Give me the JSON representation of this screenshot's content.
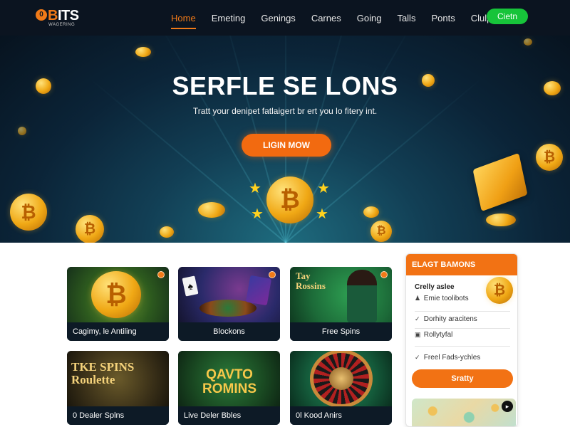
{
  "nav": {
    "logo_mark": "0",
    "logo_main": "BITS",
    "logo_tag": "WAGERING",
    "items": [
      {
        "label": "Home",
        "active": true
      },
      {
        "label": "Emeting",
        "active": false
      },
      {
        "label": "Genings",
        "active": false
      },
      {
        "label": "Carnes",
        "active": false
      },
      {
        "label": "Going",
        "active": false
      },
      {
        "label": "Talls",
        "active": false
      },
      {
        "label": "Ponts",
        "active": false
      },
      {
        "label": "Clulp",
        "active": false
      }
    ],
    "join_label": "Cietn"
  },
  "hero": {
    "title": "SERFLE SE LONS",
    "subtitle": "Tratt your denipet fatlaigert br ert you lo fitery int.",
    "button_label": "LIGIN MOW",
    "coin_symbol": "₿"
  },
  "cards": [
    {
      "label": "Cagimy, le Antiling",
      "art": "₿"
    },
    {
      "label": "Blockons",
      "art": "♠"
    },
    {
      "label": "Free Spins",
      "art": "Tay Rossins"
    },
    {
      "label": "0 Dealer Splns",
      "art": "TKE SPINS Roulette"
    },
    {
      "label": "Live Deler Bbles",
      "art": "QAVTO ROMINS"
    },
    {
      "label": "0l Kood Anirs",
      "art": ""
    }
  ],
  "sidebar": {
    "title": "ELAGT BAMONS",
    "subtitle": "Crelly aslee",
    "items": [
      {
        "label": "Emie toolibots",
        "icon": "user-icon"
      },
      {
        "label": "Dorhity aracitens",
        "icon": "check-icon"
      },
      {
        "label": "Rollytyfal",
        "icon": "box-icon"
      },
      {
        "label": "Freel Fads-ychles",
        "icon": "check-icon"
      }
    ],
    "button_label": "Sratty",
    "coin_symbol": "₿"
  },
  "colors": {
    "accent": "#f07a18",
    "join": "#17c43a",
    "nav_bg": "#0b1420",
    "card_bg": "#0d1a26"
  }
}
